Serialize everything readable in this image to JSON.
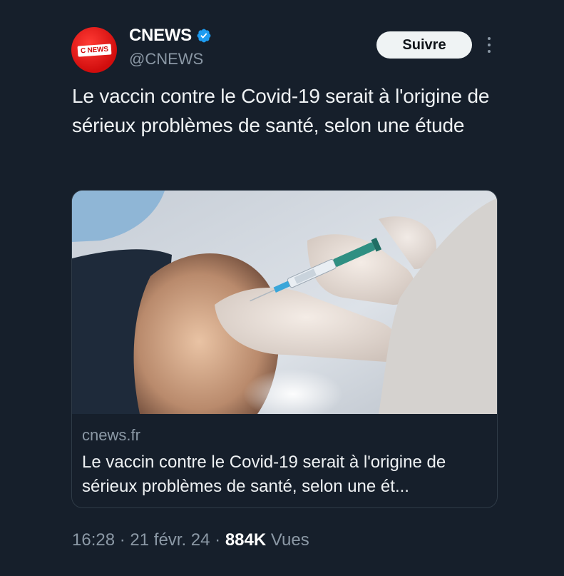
{
  "account": {
    "name": "CNEWS",
    "handle": "@CNEWS",
    "avatar_logo": "C NEWS",
    "verified_icon": "verified-badge-icon",
    "verified_color": "#1d9bf0"
  },
  "follow_label": "Suivre",
  "more_icon": "more-vertical-icon",
  "tweet_text": "Le vaccin contre le Covid-19 serait à l'origine de sérieux problèmes de santé, selon une étude",
  "card": {
    "domain": "cnews.fr",
    "title": "Le vaccin contre le Covid-19 serait à l'origine de sérieux problèmes de santé, selon une ét..."
  },
  "meta": {
    "time": "16:28",
    "separator": "·",
    "date": "21 févr. 24",
    "views_count": "884K",
    "views_label": "Vues"
  },
  "colors": {
    "background": "#161f2b",
    "text": "#e7e9ea",
    "muted": "#8b98a5",
    "brand_red": "#d10d0d"
  }
}
